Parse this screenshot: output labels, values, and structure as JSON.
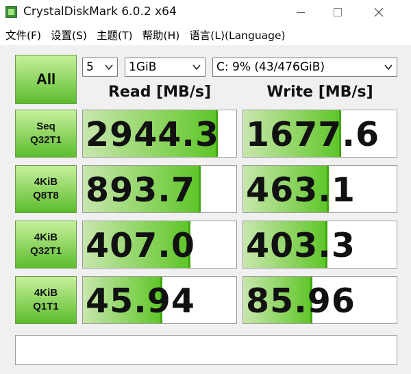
{
  "window": {
    "title": "CrystalDiskMark 6.0.2 x64",
    "icons": {
      "app": "app-icon",
      "minimize": "minimize-icon",
      "maximize": "maximize-icon",
      "close": "close-icon"
    }
  },
  "menu": {
    "items": [
      "文件(F)",
      "设置(S)",
      "主题(T)",
      "帮助(H)",
      "语言(L)(Language)"
    ]
  },
  "controls": {
    "all_label": "All",
    "count": "5",
    "size": "1GiB",
    "drive": "C: 9% (43/476GiB)",
    "dropdown_icon": "chevron-down-icon"
  },
  "headers": {
    "read": "Read [MB/s]",
    "write": "Write [MB/s]"
  },
  "rows": [
    {
      "label1": "Seq",
      "label2": "Q32T1",
      "read": "2944.3",
      "write": "1677.6",
      "read_fill": 0.88,
      "write_fill": 0.64
    },
    {
      "label1": "4KiB",
      "label2": "Q8T8",
      "read": "893.7",
      "write": "463.1",
      "read_fill": 0.77,
      "write_fill": 0.56
    },
    {
      "label1": "4KiB",
      "label2": "Q32T1",
      "read": "407.0",
      "write": "403.3",
      "read_fill": 0.7,
      "write_fill": 0.55
    },
    {
      "label1": "4KiB",
      "label2": "Q1T1",
      "read": "45.94",
      "write": "85.96",
      "read_fill": 0.52,
      "write_fill": 0.45
    }
  ],
  "colors": {
    "accent_green": "#5cc526",
    "button_top": "#c6f09c",
    "button_bottom": "#5cbd2d"
  }
}
